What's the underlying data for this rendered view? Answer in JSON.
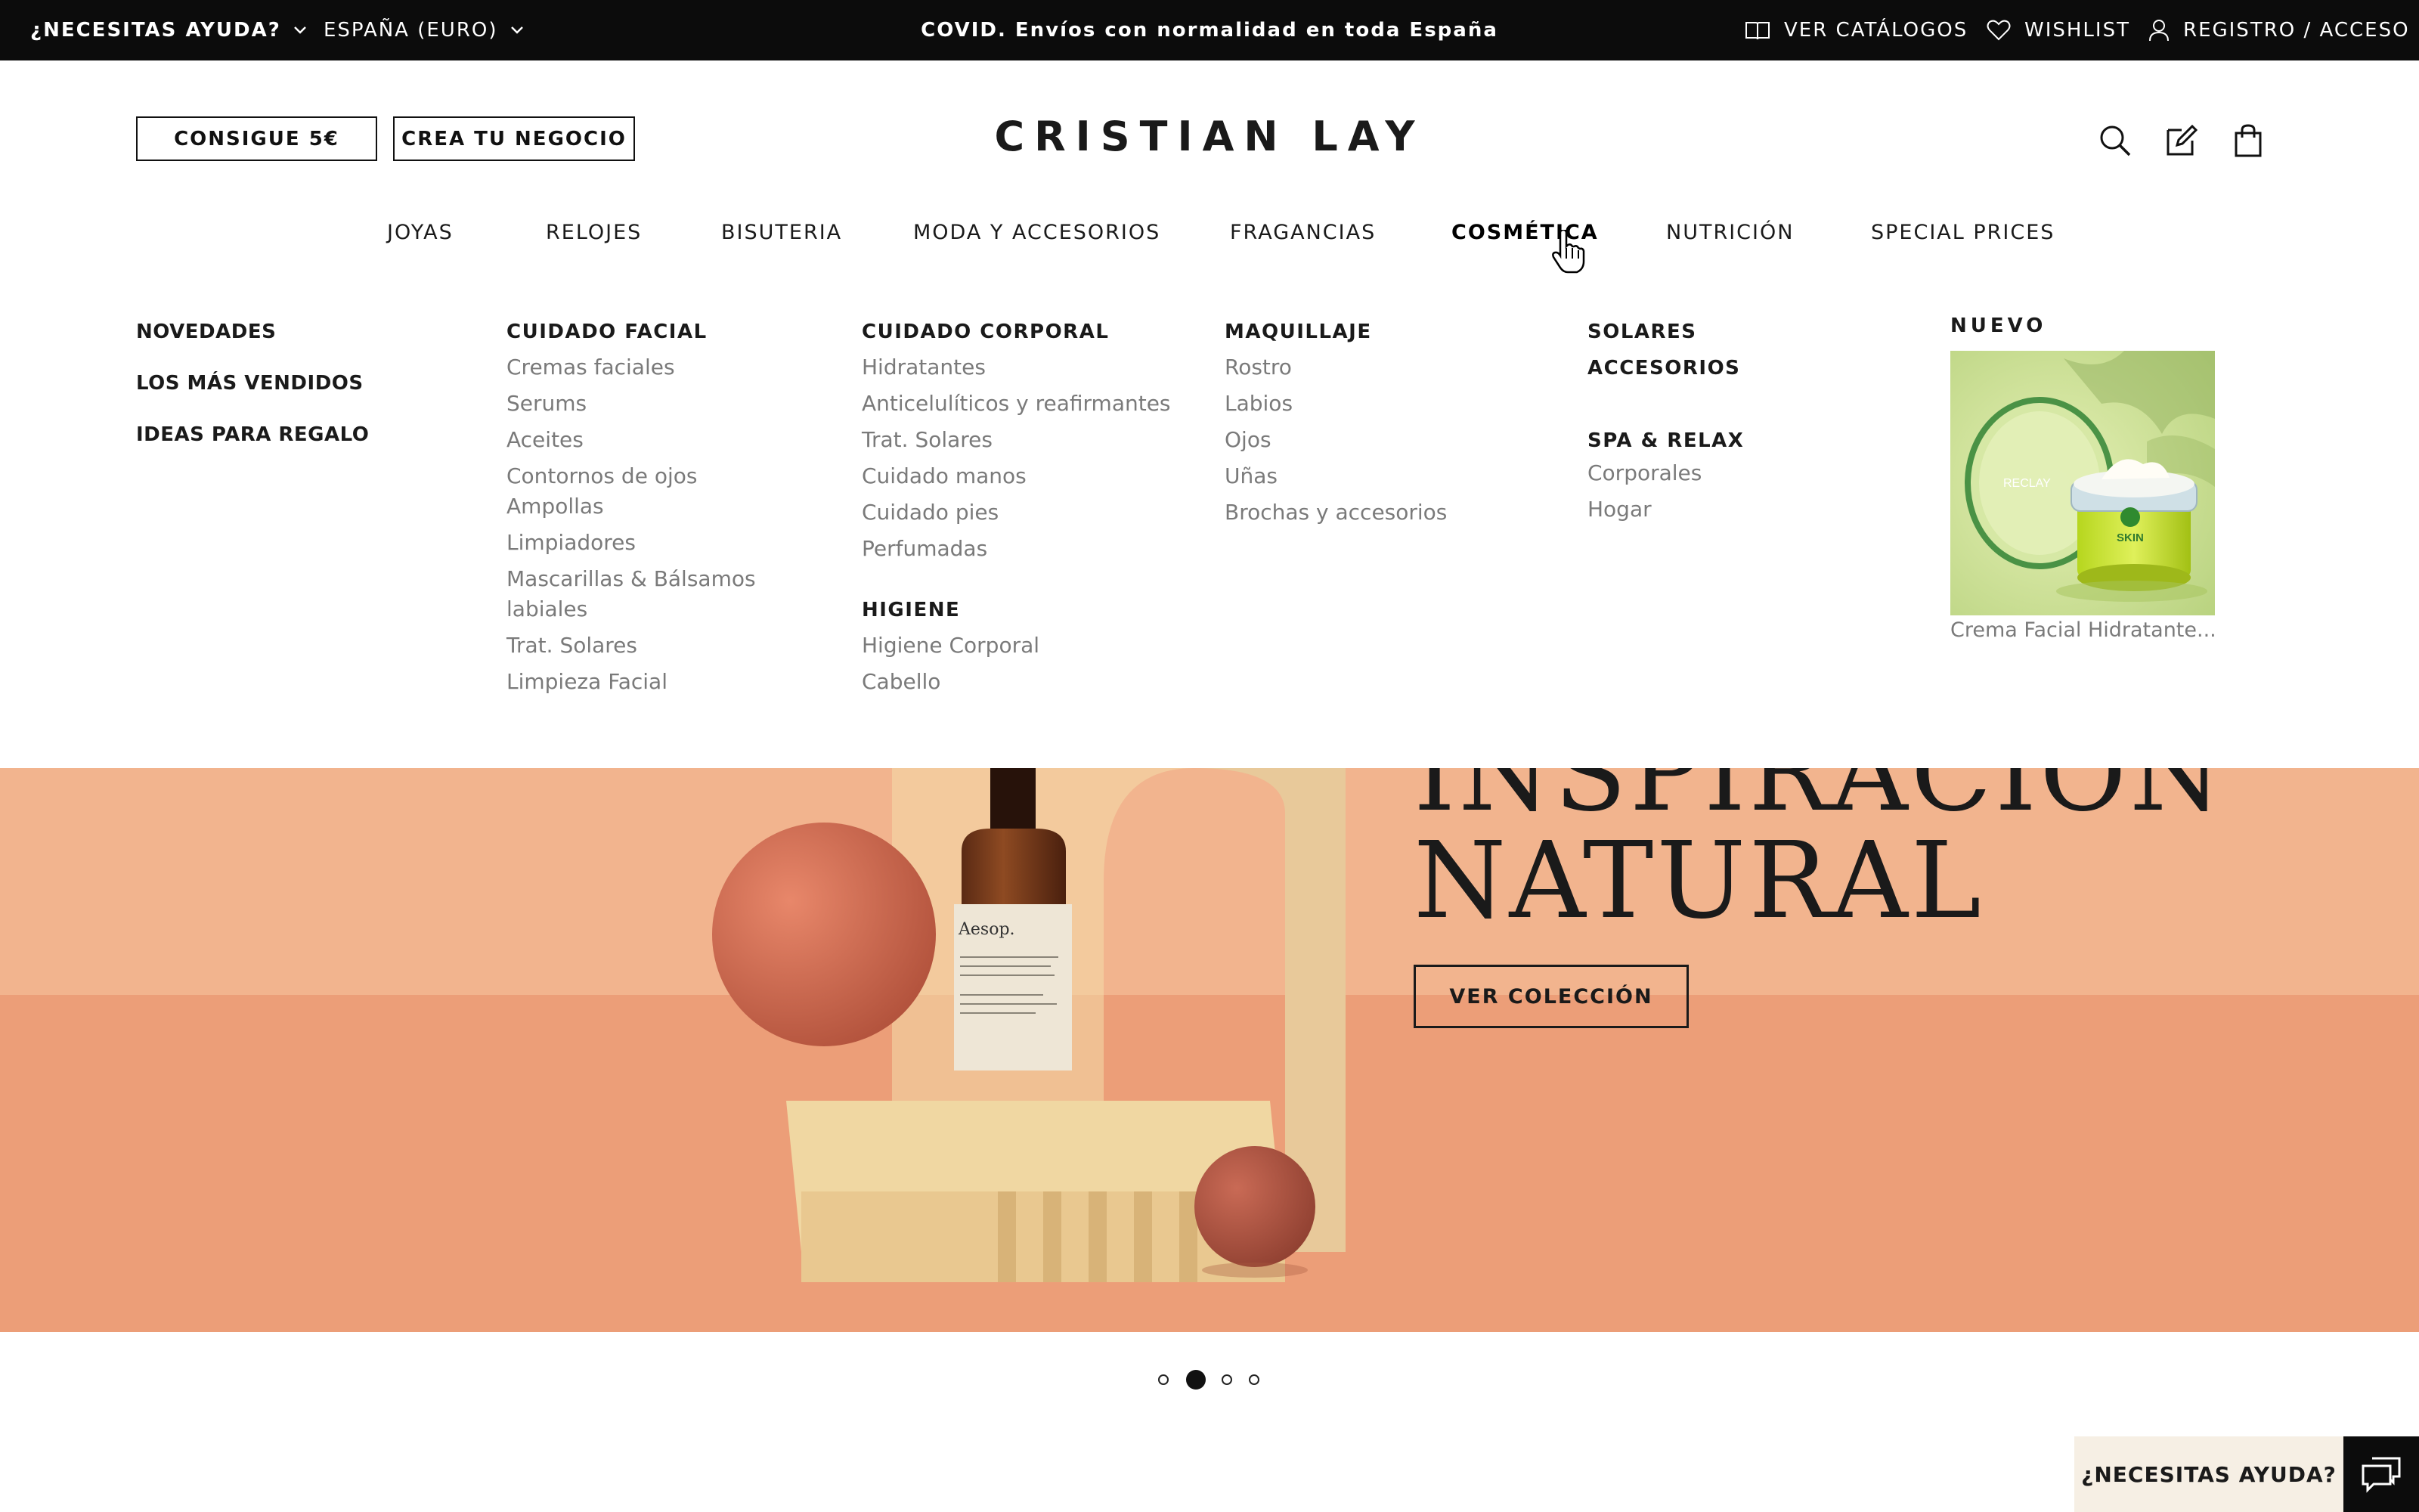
{
  "topbar": {
    "help_label": "¿NECESITAS AYUDA?",
    "country_label": "ESPAÑA (EURO)",
    "promo_text": "COVID. Envíos con normalidad en toda España",
    "catalogs_label": "VER CATÁLOGOS",
    "wishlist_label": "WISHLIST",
    "login_label": "REGISTRO / ACCESO"
  },
  "header": {
    "promo_button": "CONSIGUE 5€",
    "business_button": "CREA TU NEGOCIO",
    "logo_text": "CRISTIAN LAY",
    "icons": [
      "search-icon",
      "edit-icon",
      "bag-icon"
    ]
  },
  "nav": {
    "items": [
      "JOYAS",
      "RELOJES",
      "BISUTERIA",
      "MODA Y ACCESORIOS",
      "FRAGANCIAS",
      "COSMÉTICA",
      "NUTRICIÓN",
      "SPECIAL PRICES"
    ],
    "active": "COSMÉTICA"
  },
  "megamenu": {
    "left_links": [
      "NOVEDADES",
      "LOS MÁS VENDIDOS",
      "IDEAS PARA REGALO"
    ],
    "cuidado_facial": {
      "title": "CUIDADO FACIAL",
      "links": [
        "Cremas faciales",
        "Serums",
        "Aceites",
        "Contornos de ojos",
        "Ampollas",
        "Limpiadores",
        "Mascarillas & Bálsamos",
        "labiales",
        "Trat. Solares",
        "Limpieza Facial"
      ]
    },
    "cuidado_corporal": {
      "title": "CUIDADO CORPORAL",
      "links": [
        "Hidratantes",
        "Anticelulíticos y reafirmantes",
        "Trat. Solares",
        "Cuidado manos",
        "Cuidado pies",
        "Perfumadas"
      ]
    },
    "higiene": {
      "title": "HIGIENE",
      "links": [
        "Higiene Corporal",
        "Cabello"
      ]
    },
    "maquillaje": {
      "title": "MAQUILLAJE",
      "links": [
        "Rostro",
        "Labios",
        "Ojos",
        "Uñas",
        "Brochas y accesorios"
      ]
    },
    "solares_title": "SOLARES",
    "accesorios_title": "ACCESORIOS",
    "spa": {
      "title": "SPA & RELAX",
      "links": [
        "Corporales",
        "Hogar"
      ]
    },
    "nuevo": {
      "label": "NUEVO",
      "caption": "Crema Facial Hidratante...",
      "image_text_1": "RECLAY",
      "image_text_2": "SKIN"
    }
  },
  "hero": {
    "title_line1": "INSPIRACIÓN",
    "title_line2": "NATURAL",
    "bottle_label": "Aesop.",
    "button_label": "VER COLECCIÓN",
    "background_color": "#f0ad86"
  },
  "carousel": {
    "count": 4,
    "active_index": 1
  },
  "help_widget": {
    "label": "¿NECESITAS AYUDA?"
  },
  "colors": {
    "topbar_bg": "#0c0c0c",
    "link_gray": "#7a7a7a",
    "text_dark": "#1a1a1a"
  }
}
